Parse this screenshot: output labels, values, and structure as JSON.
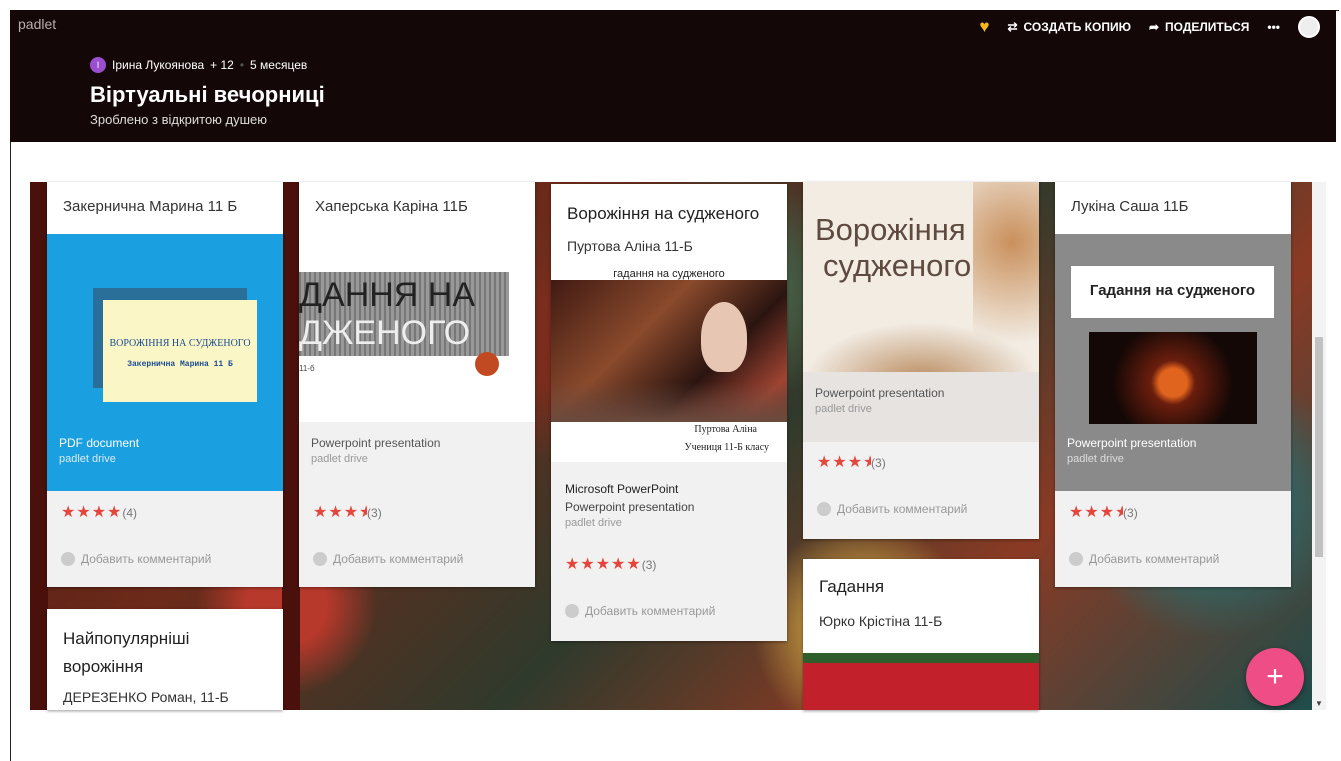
{
  "header": {
    "brand": "padlet",
    "actions": {
      "copy": "СОЗДАТЬ КОПИЮ",
      "share": "ПОДЕЛИТЬСЯ",
      "more": "•••"
    },
    "author": "Ірина Лукоянова",
    "author_initial": "І",
    "contributors": "+ 12",
    "sep": "•",
    "age": "5 месяцев",
    "title": "Віртуальні вечорниці",
    "subtitle": "Зроблено з відкритою душею"
  },
  "comment_label": "Добавить комментарий",
  "cards": [
    {
      "title": "Закернична Марина 11 Б",
      "attach_type": "PDF document",
      "attach_source": "padlet drive",
      "thumb_line1": "ВОРОЖІННЯ НА СУДЖЕНОГО",
      "thumb_line2": "Закернична Марина 11 Б",
      "stars": "★★★★",
      "rating_count": "(4)",
      "rating": 4
    },
    {
      "title": "Хаперська Каріна 11Б",
      "attach_type": "Powerpoint presentation",
      "attach_source": "padlet drive",
      "thumb_line1": "ДАННЯ НА",
      "thumb_line2": "ДЖЕНОГО",
      "thumb_line3": "11-б",
      "stars": "★★★",
      "half": "★",
      "rating_count": "(3)",
      "rating": 3.5
    },
    {
      "title": "Ворожіння на судженого",
      "body": "Пуртова Аліна 11-Б",
      "thumb_caption_top": "гадання на судженого",
      "thumb_caption_1": "Пуртова Аліна",
      "thumb_caption_2": "Учениця 11-Б класу",
      "attach_app": "Microsoft PowerPoint",
      "attach_type": "Powerpoint presentation",
      "attach_source": "padlet drive",
      "stars": "★★★★★",
      "rating_count": "(3)",
      "rating": 5
    },
    {
      "thumb_line1": "Ворожіння",
      "thumb_line2": "судженого",
      "attach_type": "Powerpoint presentation",
      "attach_source": "padlet drive",
      "stars": "★★★",
      "half": "★",
      "rating_count": "(3)",
      "rating": 3.5
    },
    {
      "title": "Лукіна Саша 11Б",
      "thumb_line1": "Гадання на судженого",
      "attach_type": "Powerpoint presentation",
      "attach_source": "padlet drive",
      "stars": "★★★",
      "half": "★",
      "rating_count": "(3)",
      "rating": 3.5
    },
    {
      "title": "Найпопулярніші ворожіння",
      "body": "ДЕРЕЗЕНКО Роман, 11-Б"
    },
    {
      "title": "Гадання",
      "body": "Юрко Крістіна 11-Б"
    }
  ],
  "fab": "+",
  "colors": {
    "header_bg": "#130807",
    "accent_star": "#e4463c",
    "fab": "#ef4d86",
    "pdf_blue": "#1a9fe0",
    "heart": "#f6b91c"
  }
}
